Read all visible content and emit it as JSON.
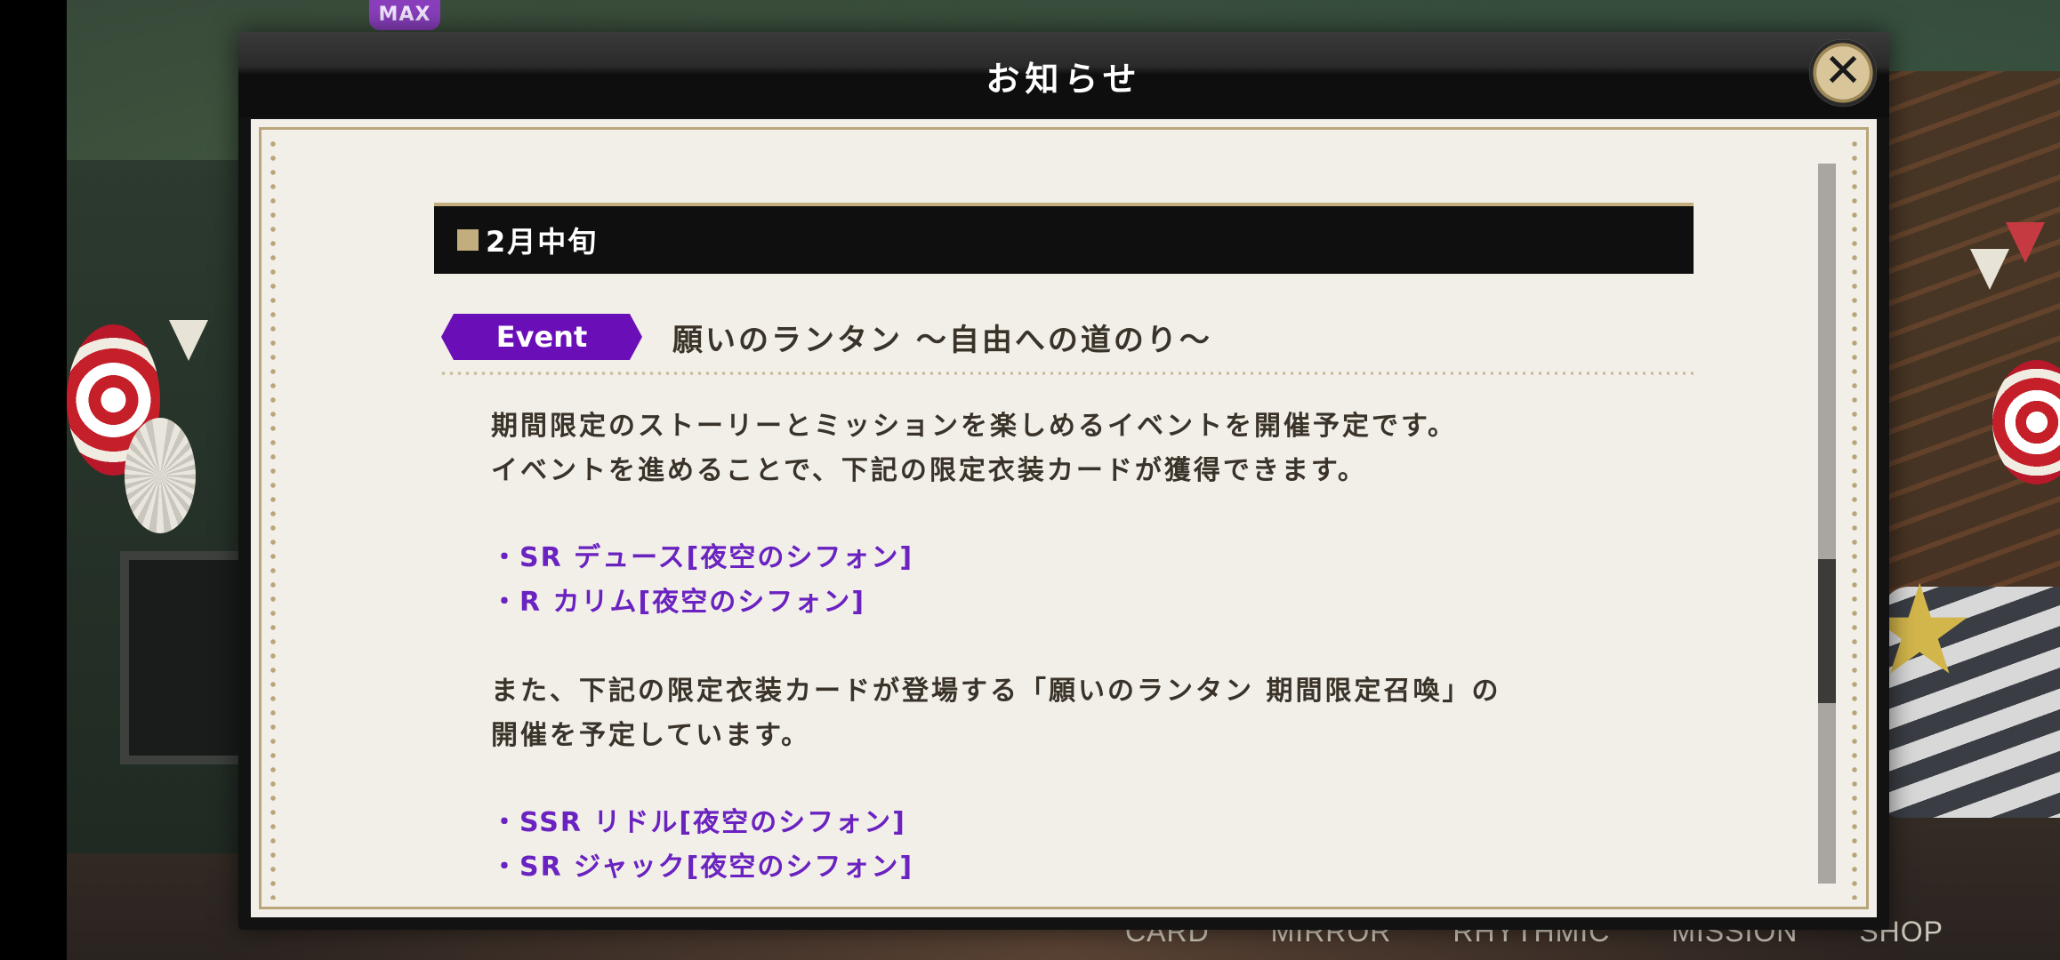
{
  "background": {
    "badge": "MAX",
    "nav_items": [
      "CARD",
      "MIRROR",
      "RHYTHMIC",
      "MISSION",
      "SHOP"
    ]
  },
  "dialog": {
    "title": "お知らせ",
    "close_label": "✕"
  },
  "notice": {
    "section_heading": "2月中旬",
    "event_tag": "Event",
    "event_title": "願いのランタン 〜自由への道のり〜",
    "paragraph1": [
      "期間限定のストーリーとミッションを楽しめるイベントを開催予定です。",
      "イベントを進めることで、下記の限定衣装カードが獲得できます。"
    ],
    "event_cards": [
      "・SR デュース[夜空のシフォン]",
      "・R カリム[夜空のシフォン]"
    ],
    "paragraph2": [
      "また、下記の限定衣装カードが登場する「願いのランタン 期間限定召喚」の",
      "開催を予定しています。"
    ],
    "summon_cards": [
      "・SSR リドル[夜空のシフォン]",
      "・SR ジャック[夜空のシフォン]"
    ]
  },
  "colors": {
    "event_tag": "#6a0fb8",
    "card_text": "#6a22c0",
    "gold_accent": "#c2ad7e"
  }
}
